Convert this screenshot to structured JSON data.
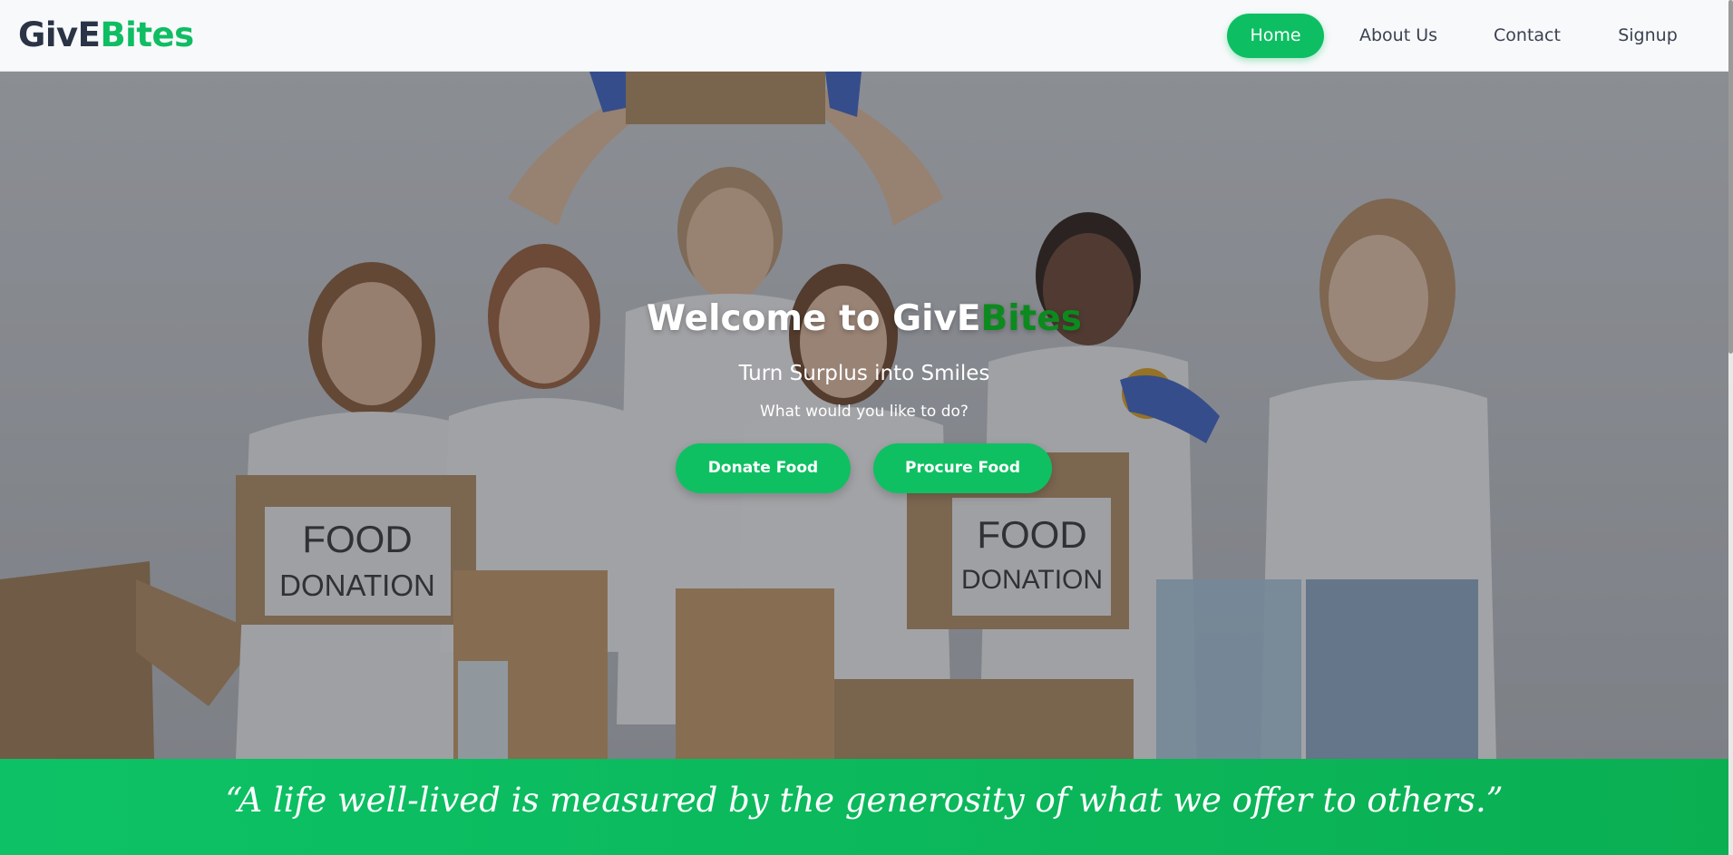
{
  "brand": {
    "logo_part1": "GivE",
    "logo_part2": "Bites",
    "primary_color": "#0fbd62",
    "dark_color": "#2a3446"
  },
  "nav": {
    "items": [
      {
        "label": "Home",
        "active": true
      },
      {
        "label": "About Us",
        "active": false
      },
      {
        "label": "Contact",
        "active": false
      },
      {
        "label": "Signup",
        "active": false
      }
    ]
  },
  "hero": {
    "title_prefix": "Welcome to GivE",
    "title_accent": "Bites",
    "subtitle": "Turn Surplus into Smiles",
    "question": "What would you like to do?",
    "buttons": {
      "donate": "Donate Food",
      "procure": "Procure Food"
    },
    "sign_line1": "FOOD",
    "sign_line2": "DONATION"
  },
  "quote": {
    "text": "“A life well-lived is measured by the generosity of what we offer to others.”"
  }
}
